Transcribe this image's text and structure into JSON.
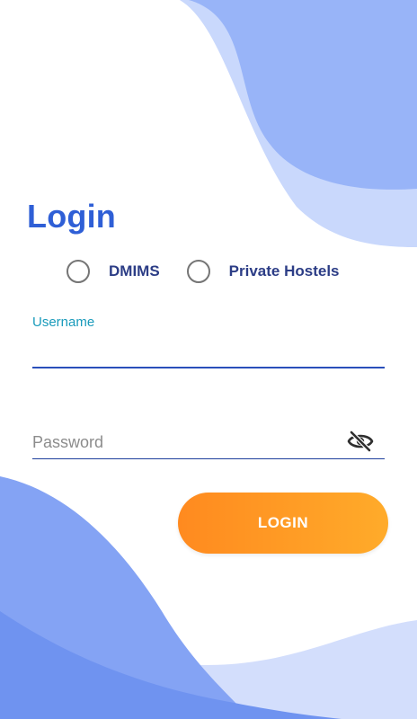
{
  "screen": {
    "title": "Login",
    "accent_color": "#2f5fd6",
    "wave_color_light": "#c7d6fb",
    "wave_color_dark": "#7f9ff3"
  },
  "options": {
    "items": [
      {
        "label": "DMIMS",
        "selected": false
      },
      {
        "label": "Private Hostels",
        "selected": false
      }
    ]
  },
  "username": {
    "label": "Username",
    "value": ""
  },
  "password": {
    "placeholder": "Password",
    "value": "",
    "visibility_icon": "eye-off-icon"
  },
  "login_button": {
    "label": "LOGIN",
    "color_start": "#ff8a1f",
    "color_end": "#ffab2a"
  }
}
